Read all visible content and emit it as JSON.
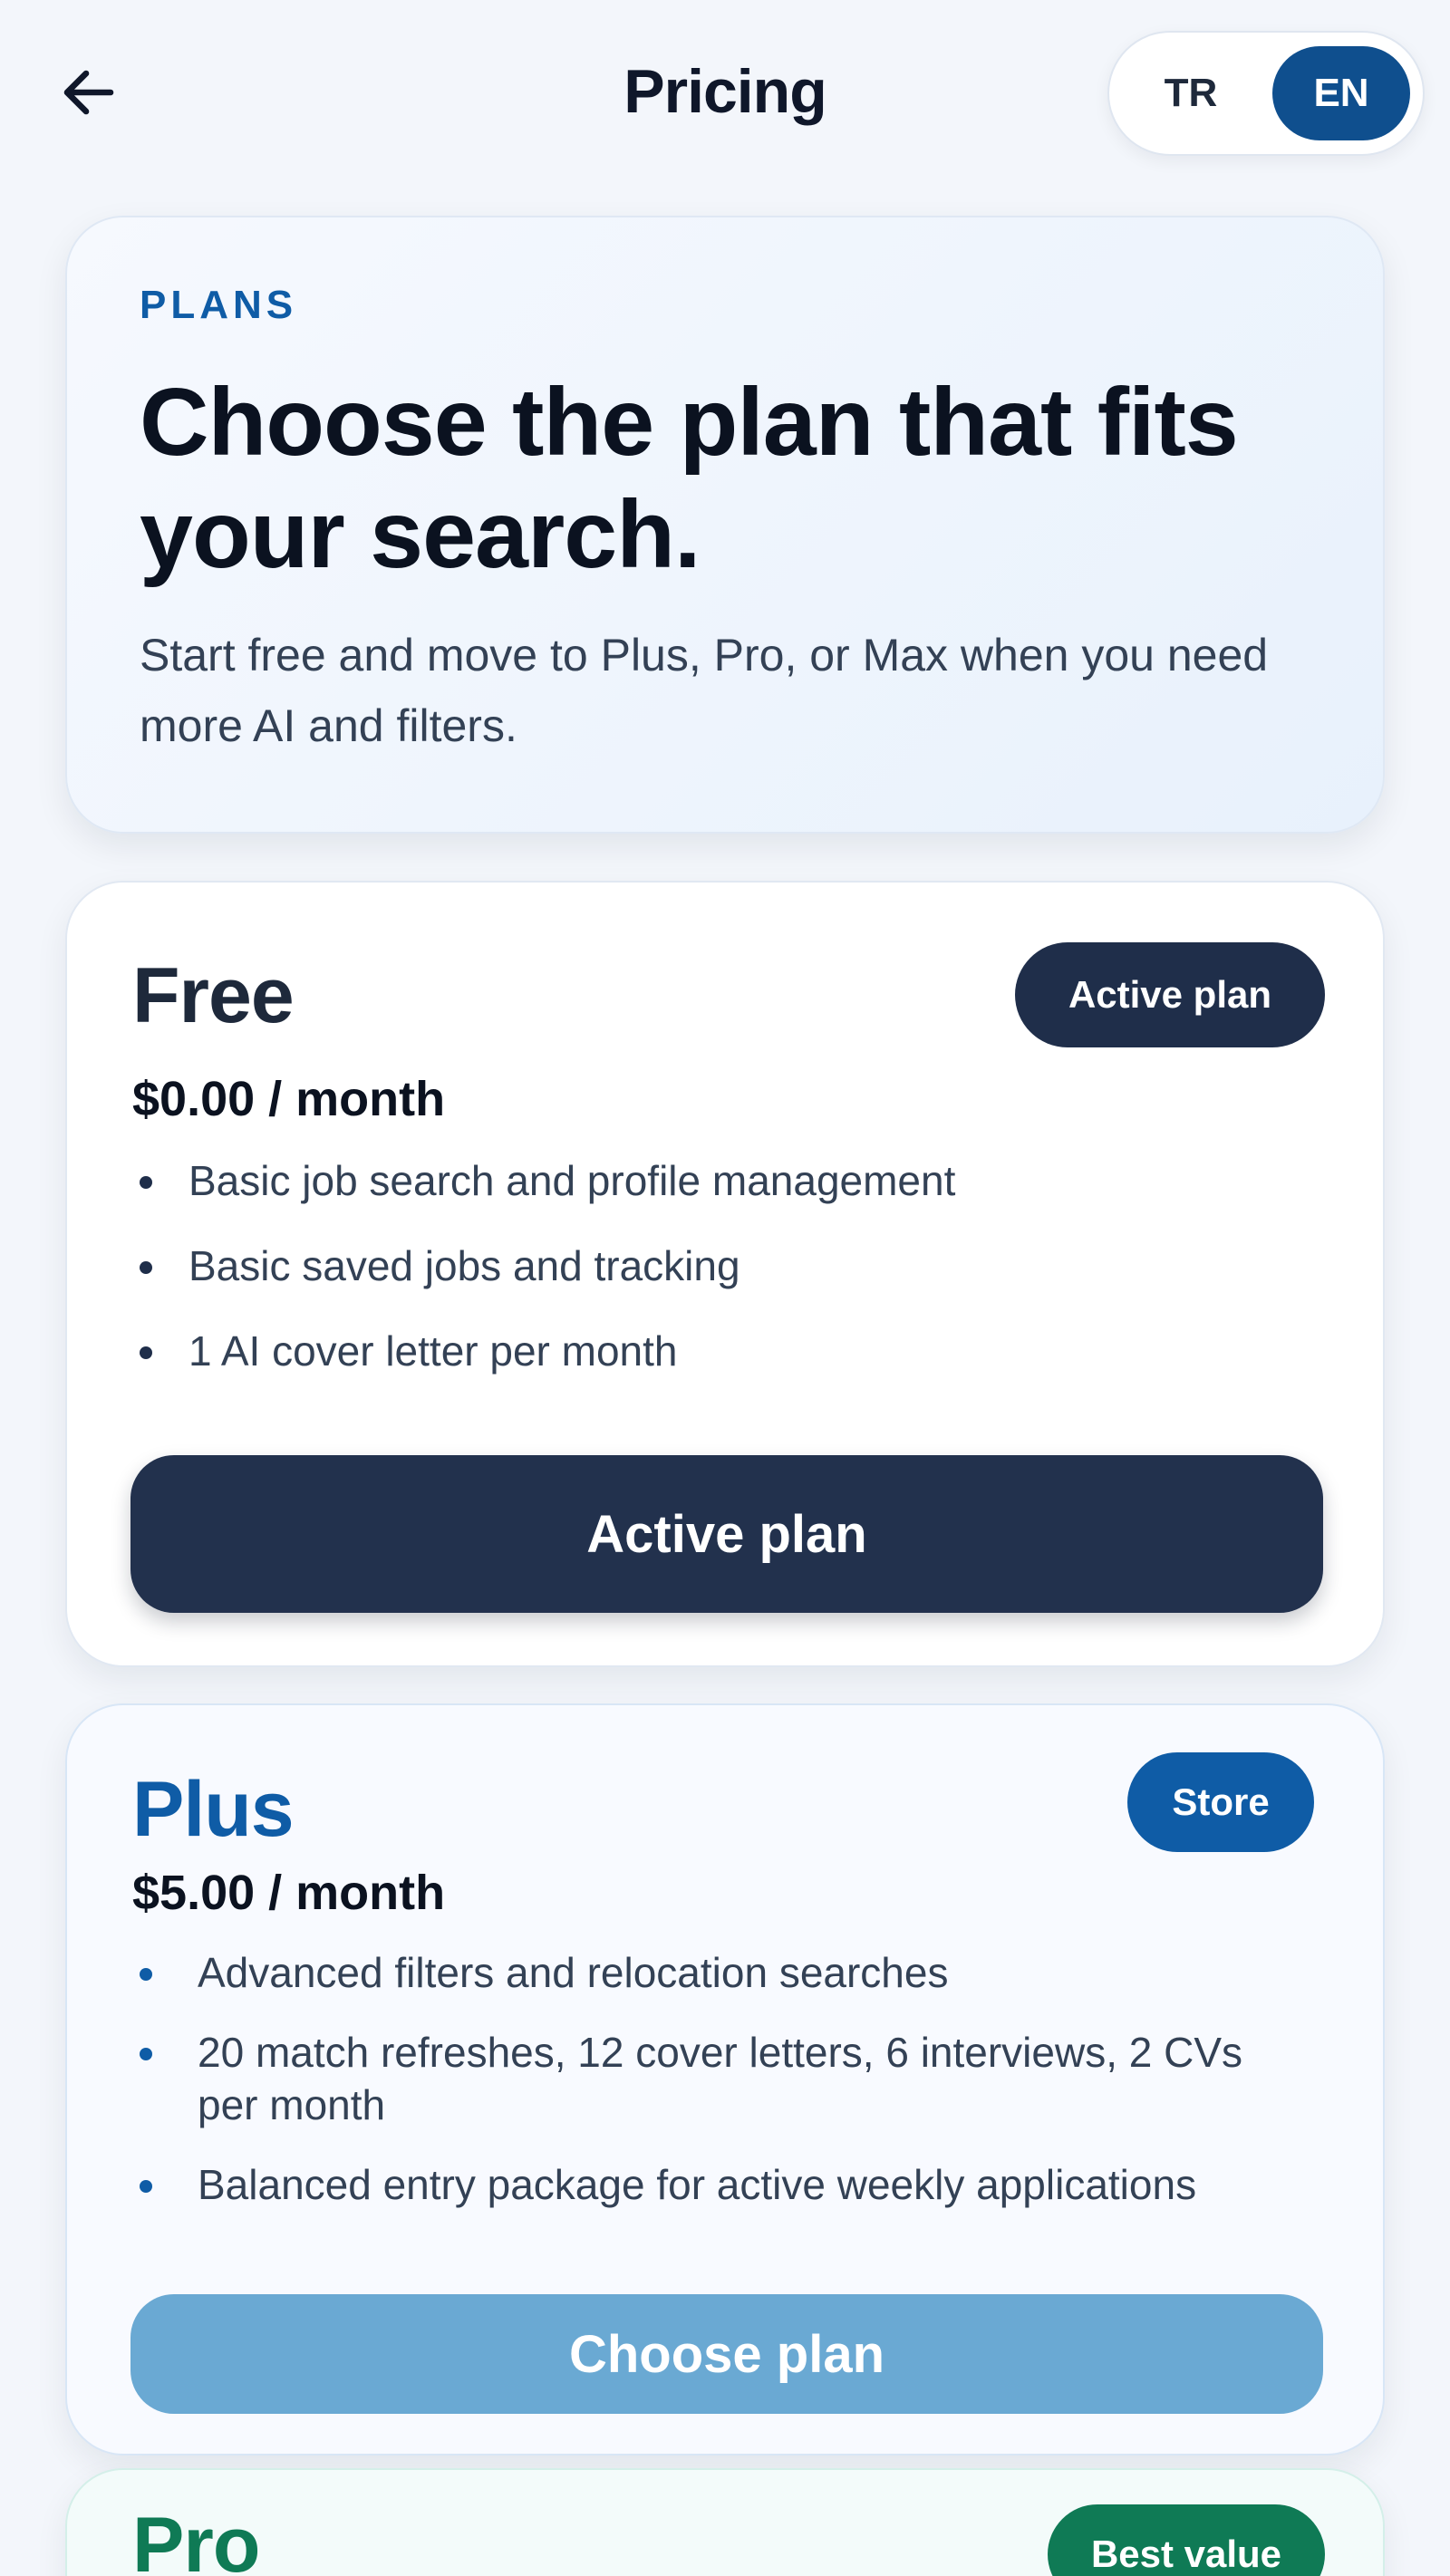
{
  "header": {
    "title": "Pricing",
    "back_icon": "arrow-left-icon",
    "languages": {
      "tr": "TR",
      "en": "EN",
      "selected": "EN"
    }
  },
  "hero": {
    "eyebrow": "PLANS",
    "heading": "Choose the plan that fits your search.",
    "subtitle": "Start free and move to Plus, Pro, or Max when you need more AI and filters."
  },
  "plans": [
    {
      "name": "Free",
      "badge": "Active plan",
      "price": "$0.00 / month",
      "features": [
        "Basic job search and profile management",
        "Basic saved jobs and tracking",
        "1 AI cover letter per month"
      ],
      "cta": "Active plan"
    },
    {
      "name": "Plus",
      "badge": "Store",
      "price": "$5.00 / month",
      "features": [
        "Advanced filters and relocation searches",
        "20 match refreshes, 12 cover letters, 6 interviews, 2 CVs per month",
        "Balanced entry package for active weekly applications"
      ],
      "cta": "Choose plan"
    },
    {
      "name": "Pro",
      "badge": "Best value"
    }
  ],
  "colors": {
    "background": "#f3f6fb",
    "primary_blue": "#0f5ca6",
    "dark_navy": "#1f2e4a",
    "pro_green": "#0f7a55",
    "plus_cta_light_blue": "#6aa9d3"
  }
}
